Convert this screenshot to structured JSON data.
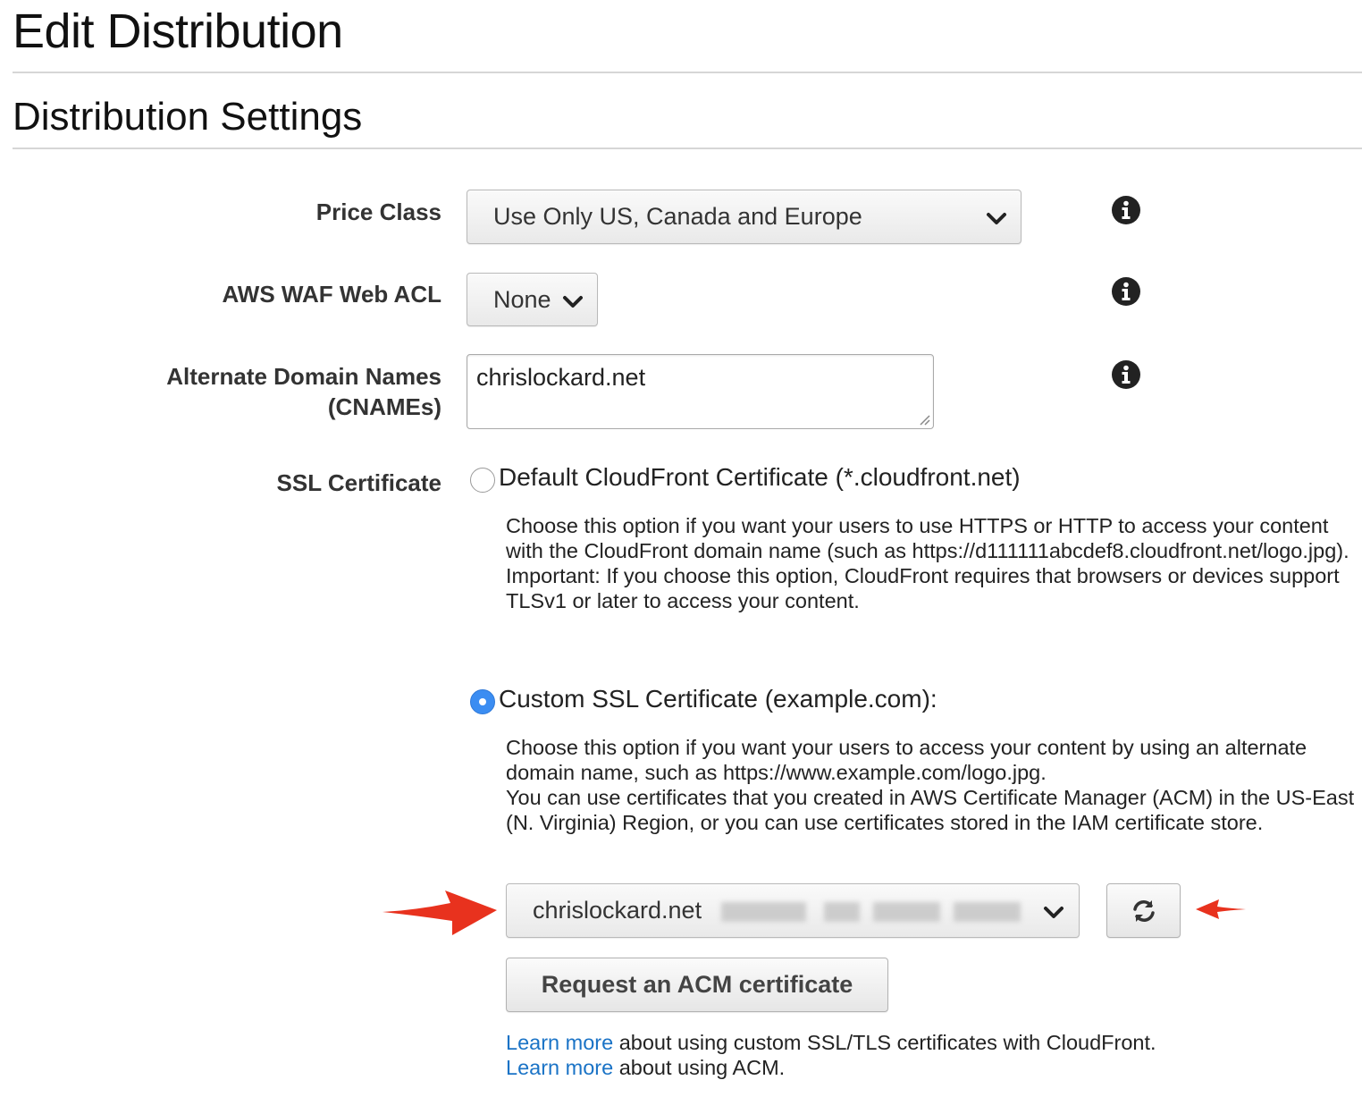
{
  "page": {
    "title": "Edit Distribution",
    "section_title": "Distribution Settings"
  },
  "price_class": {
    "label": "Price Class",
    "selected": "Use Only US, Canada and Europe",
    "info_icon": "info-icon"
  },
  "waf": {
    "label": "AWS WAF Web ACL",
    "selected": "None",
    "info_icon": "info-icon"
  },
  "cnames": {
    "label_line1": "Alternate Domain Names",
    "label_line2": "(CNAMEs)",
    "value": "chrislockard.net",
    "info_icon": "info-icon"
  },
  "ssl": {
    "label": "SSL Certificate",
    "options": [
      {
        "label": "Default CloudFront Certificate (*.cloudfront.net)",
        "selected": false,
        "help": [
          "Choose this option if you want your users to use HTTPS or HTTP to access your content with the CloudFront domain name (such as https://d111111abcdef8.cloudfront.net/logo.jpg).",
          "Important: If you choose this option, CloudFront requires that browsers or devices support TLSv1 or later to access your content."
        ]
      },
      {
        "label": "Custom SSL Certificate (example.com):",
        "selected": true,
        "help": [
          "Choose this option if you want your users to access your content by using an alternate domain name, such as https://www.example.com/logo.jpg.",
          "You can use certificates that you created in AWS Certificate Manager (ACM) in the US-East (N. Virginia) Region, or you can use certificates stored in the IAM certificate store."
        ]
      }
    ],
    "certificate_select": {
      "selected": "chrislockard.net"
    },
    "refresh_icon": "refresh-icon",
    "request_button": "Request an ACM certificate",
    "links": [
      {
        "link_text": "Learn more",
        "text": " about using custom SSL/TLS certificates with CloudFront."
      },
      {
        "link_text": "Learn more",
        "text": " about using ACM."
      }
    ]
  },
  "colors": {
    "accent_radio": "#3b8df2",
    "link": "#1a73c6",
    "annotation_arrow": "#e8321e"
  }
}
